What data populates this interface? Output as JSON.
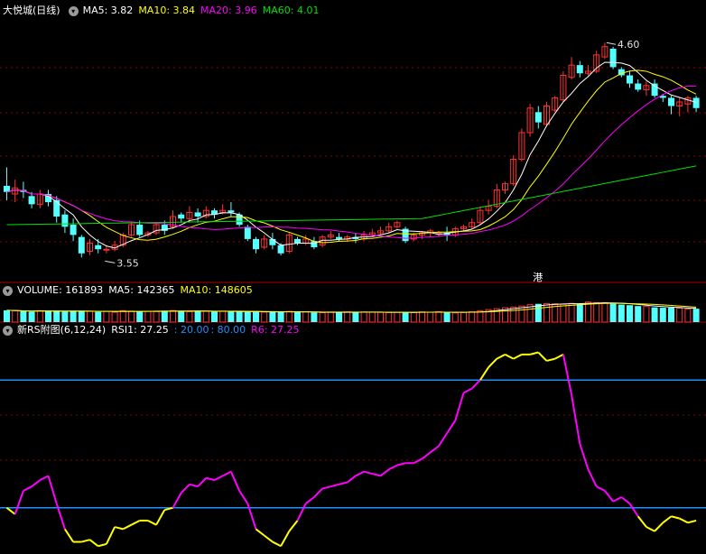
{
  "colors": {
    "up": "#ff3232",
    "down": "#54ffff",
    "ma5": "#ffffff",
    "ma10": "#ffff00",
    "ma20": "#ff00ff",
    "ma60": "#00e000",
    "rsi": "#ff00ff",
    "rsi_hot": "#ffff00",
    "hline": "#1e90ff",
    "border": "#b00000"
  },
  "price_panel": {
    "stock": "大悦城(日线)",
    "ma5": "MA5: 3.82",
    "ma10": "MA10: 3.84",
    "ma20": "MA20: 3.96",
    "ma60": "MA60: 4.01",
    "max_label": "4.60",
    "min_label": "3.55",
    "marker": "港"
  },
  "volume_panel": {
    "title": "VOLUME: 161893",
    "ma5": "MA5: 142365",
    "ma10": "MA10: 148605"
  },
  "rsi_panel": {
    "title": "新RS附图(6,12,24)",
    "rsi1": "RSI1: 27.25",
    "l20": ": 20.00",
    "l80": ": 80.00",
    "r6": "R6: 27.25"
  },
  "chart_data": {
    "type": "candlestick",
    "ylim": [
      3.45,
      4.72
    ],
    "candles": [
      [
        3.9,
        3.87,
        3.99,
        3.83
      ],
      [
        3.86,
        3.89,
        3.93,
        3.82
      ],
      [
        3.88,
        3.87,
        3.92,
        3.84
      ],
      [
        3.85,
        3.81,
        3.87,
        3.79
      ],
      [
        3.81,
        3.86,
        3.88,
        3.79
      ],
      [
        3.86,
        3.82,
        3.88,
        3.8
      ],
      [
        3.83,
        3.75,
        3.85,
        3.72
      ],
      [
        3.76,
        3.7,
        3.78,
        3.67
      ],
      [
        3.71,
        3.66,
        3.74,
        3.63
      ],
      [
        3.65,
        3.57,
        3.66,
        3.55
      ],
      [
        3.58,
        3.62,
        3.64,
        3.56
      ],
      [
        3.61,
        3.59,
        3.64,
        3.57
      ],
      [
        3.59,
        3.59,
        3.61,
        3.57
      ],
      [
        3.59,
        3.61,
        3.63,
        3.58
      ],
      [
        3.61,
        3.66,
        3.67,
        3.6
      ],
      [
        3.66,
        3.71,
        3.72,
        3.65
      ],
      [
        3.71,
        3.66,
        3.73,
        3.65
      ],
      [
        3.66,
        3.67,
        3.68,
        3.65
      ],
      [
        3.67,
        3.71,
        3.72,
        3.66
      ],
      [
        3.71,
        3.68,
        3.73,
        3.66
      ],
      [
        3.7,
        3.75,
        3.78,
        3.69
      ],
      [
        3.76,
        3.74,
        3.77,
        3.72
      ],
      [
        3.74,
        3.77,
        3.8,
        3.72
      ],
      [
        3.77,
        3.75,
        3.79,
        3.72
      ],
      [
        3.75,
        3.78,
        3.8,
        3.74
      ],
      [
        3.78,
        3.76,
        3.79,
        3.74
      ],
      [
        3.77,
        3.78,
        3.81,
        3.76
      ],
      [
        3.78,
        3.77,
        3.82,
        3.75
      ],
      [
        3.76,
        3.71,
        3.77,
        3.7
      ],
      [
        3.7,
        3.64,
        3.71,
        3.63
      ],
      [
        3.64,
        3.59,
        3.65,
        3.57
      ],
      [
        3.6,
        3.64,
        3.66,
        3.59
      ],
      [
        3.64,
        3.61,
        3.67,
        3.59
      ],
      [
        3.61,
        3.57,
        3.62,
        3.56
      ],
      [
        3.58,
        3.66,
        3.67,
        3.57
      ],
      [
        3.64,
        3.62,
        3.65,
        3.61
      ],
      [
        3.62,
        3.64,
        3.66,
        3.61
      ],
      [
        3.63,
        3.6,
        3.65,
        3.59
      ],
      [
        3.61,
        3.65,
        3.66,
        3.6
      ],
      [
        3.65,
        3.66,
        3.68,
        3.64
      ],
      [
        3.65,
        3.64,
        3.67,
        3.63
      ],
      [
        3.64,
        3.65,
        3.66,
        3.63
      ],
      [
        3.65,
        3.64,
        3.67,
        3.62
      ],
      [
        3.64,
        3.66,
        3.68,
        3.63
      ],
      [
        3.66,
        3.67,
        3.69,
        3.65
      ],
      [
        3.67,
        3.68,
        3.7,
        3.66
      ],
      [
        3.68,
        3.7,
        3.72,
        3.67
      ],
      [
        3.7,
        3.72,
        3.73,
        3.69
      ],
      [
        3.69,
        3.63,
        3.7,
        3.62
      ],
      [
        3.64,
        3.66,
        3.67,
        3.63
      ],
      [
        3.66,
        3.67,
        3.68,
        3.64
      ],
      [
        3.67,
        3.68,
        3.69,
        3.65
      ],
      [
        3.67,
        3.67,
        3.68,
        3.65
      ],
      [
        3.67,
        3.66,
        3.7,
        3.63
      ],
      [
        3.66,
        3.69,
        3.7,
        3.65
      ],
      [
        3.69,
        3.7,
        3.71,
        3.68
      ],
      [
        3.7,
        3.72,
        3.74,
        3.69
      ],
      [
        3.72,
        3.78,
        3.8,
        3.71
      ],
      [
        3.78,
        3.8,
        3.83,
        3.76
      ],
      [
        3.8,
        3.88,
        3.91,
        3.79
      ],
      [
        3.88,
        3.91,
        3.92,
        3.86
      ],
      [
        3.91,
        4.03,
        4.05,
        3.9
      ],
      [
        4.03,
        4.16,
        4.18,
        4.02
      ],
      [
        4.16,
        4.28,
        4.3,
        4.14
      ],
      [
        4.26,
        4.21,
        4.29,
        4.18
      ],
      [
        4.2,
        4.29,
        4.31,
        4.19
      ],
      [
        4.27,
        4.33,
        4.34,
        4.26
      ],
      [
        4.32,
        4.44,
        4.46,
        4.31
      ],
      [
        4.43,
        4.49,
        4.53,
        4.42
      ],
      [
        4.49,
        4.45,
        4.51,
        4.43
      ],
      [
        4.45,
        4.46,
        4.49,
        4.44
      ],
      [
        4.46,
        4.54,
        4.56,
        4.45
      ],
      [
        4.53,
        4.58,
        4.6,
        4.52
      ],
      [
        4.57,
        4.48,
        4.58,
        4.47
      ],
      [
        4.47,
        4.44,
        4.48,
        4.43
      ],
      [
        4.44,
        4.4,
        4.46,
        4.38
      ],
      [
        4.4,
        4.37,
        4.42,
        4.36
      ],
      [
        4.37,
        4.39,
        4.41,
        4.34
      ],
      [
        4.4,
        4.34,
        4.42,
        4.33
      ],
      [
        4.34,
        4.33,
        4.35,
        4.31
      ],
      [
        4.33,
        4.29,
        4.34,
        4.25
      ],
      [
        4.29,
        4.31,
        4.33,
        4.24
      ],
      [
        4.3,
        4.33,
        4.34,
        4.26
      ],
      [
        4.33,
        4.28,
        4.34,
        4.26
      ]
    ],
    "volume_max": 200000,
    "volume": [
      97000,
      93000,
      89000,
      85000,
      94000,
      91000,
      92000,
      86000,
      89000,
      93000,
      89000,
      84000,
      88000,
      81000,
      94000,
      90000,
      89000,
      88000,
      87000,
      94000,
      95000,
      92000,
      86000,
      93000,
      89000,
      85000,
      90000,
      87000,
      86000,
      84000,
      86000,
      82000,
      83000,
      84000,
      88000,
      81000,
      84000,
      79000,
      77000,
      82000,
      80000,
      84000,
      81000,
      83000,
      82000,
      80000,
      79000,
      81000,
      82000,
      78000,
      84000,
      81000,
      86000,
      80000,
      76000,
      80000,
      85000,
      94000,
      103000,
      110000,
      118000,
      124000,
      132000,
      143000,
      150000,
      153000,
      151000,
      147000,
      154000,
      152000,
      165000,
      160000,
      160000,
      151000,
      144000,
      139000,
      132000,
      128000,
      121000,
      118000,
      119000,
      115000,
      108000,
      110000
    ],
    "rsi": [
      20,
      17,
      28,
      30,
      33,
      35,
      22,
      10,
      4,
      4,
      5,
      2,
      3,
      11,
      10,
      12,
      14,
      14,
      12,
      19,
      20,
      27,
      31,
      30,
      34,
      33,
      35,
      37,
      28,
      22,
      10,
      7,
      4,
      2,
      9,
      14,
      22,
      25,
      29,
      30,
      31,
      32,
      35,
      37,
      36,
      35,
      38,
      40,
      41,
      41,
      43,
      46,
      49,
      55,
      61,
      74,
      76,
      80,
      86,
      90,
      92,
      90,
      92,
      92,
      93,
      89,
      90,
      92,
      73,
      50,
      38,
      30,
      28,
      23,
      25,
      22,
      16,
      11,
      9,
      13,
      16,
      15,
      13,
      14
    ],
    "rsi_levels": [
      20,
      80
    ],
    "rsi_ylim": [
      0,
      100
    ]
  }
}
